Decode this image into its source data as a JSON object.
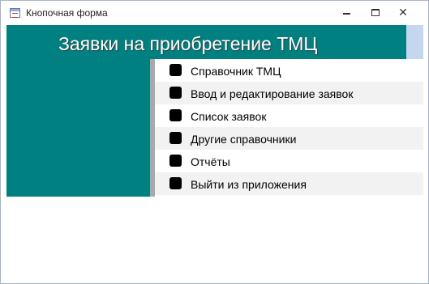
{
  "window": {
    "title": "Кнопочная форма"
  },
  "form": {
    "header_title": "Заявки на приобретение ТМЦ",
    "accent_color": "#008080",
    "menu": [
      {
        "label": "Справочник ТМЦ"
      },
      {
        "label": "Ввод и редактирование заявок"
      },
      {
        "label": "Список заявок"
      },
      {
        "label": "Другие справочники"
      },
      {
        "label": "Отчёты"
      },
      {
        "label": "Выйти из приложения"
      }
    ]
  },
  "icons": {
    "app": "form-icon",
    "minimize": "minimize-icon",
    "maximize": "restore-icon",
    "close": "close-icon"
  }
}
